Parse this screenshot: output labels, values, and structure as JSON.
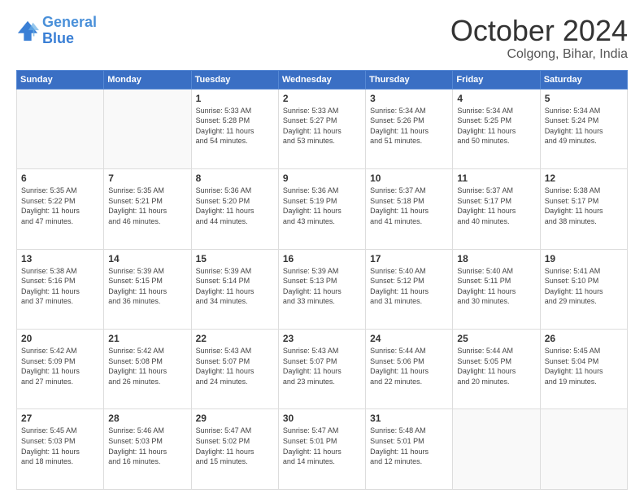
{
  "logo": {
    "line1": "General",
    "line2": "Blue"
  },
  "header": {
    "month": "October 2024",
    "location": "Colgong, Bihar, India"
  },
  "weekdays": [
    "Sunday",
    "Monday",
    "Tuesday",
    "Wednesday",
    "Thursday",
    "Friday",
    "Saturday"
  ],
  "weeks": [
    [
      {
        "day": "",
        "info": ""
      },
      {
        "day": "",
        "info": ""
      },
      {
        "day": "1",
        "info": "Sunrise: 5:33 AM\nSunset: 5:28 PM\nDaylight: 11 hours\nand 54 minutes."
      },
      {
        "day": "2",
        "info": "Sunrise: 5:33 AM\nSunset: 5:27 PM\nDaylight: 11 hours\nand 53 minutes."
      },
      {
        "day": "3",
        "info": "Sunrise: 5:34 AM\nSunset: 5:26 PM\nDaylight: 11 hours\nand 51 minutes."
      },
      {
        "day": "4",
        "info": "Sunrise: 5:34 AM\nSunset: 5:25 PM\nDaylight: 11 hours\nand 50 minutes."
      },
      {
        "day": "5",
        "info": "Sunrise: 5:34 AM\nSunset: 5:24 PM\nDaylight: 11 hours\nand 49 minutes."
      }
    ],
    [
      {
        "day": "6",
        "info": "Sunrise: 5:35 AM\nSunset: 5:22 PM\nDaylight: 11 hours\nand 47 minutes."
      },
      {
        "day": "7",
        "info": "Sunrise: 5:35 AM\nSunset: 5:21 PM\nDaylight: 11 hours\nand 46 minutes."
      },
      {
        "day": "8",
        "info": "Sunrise: 5:36 AM\nSunset: 5:20 PM\nDaylight: 11 hours\nand 44 minutes."
      },
      {
        "day": "9",
        "info": "Sunrise: 5:36 AM\nSunset: 5:19 PM\nDaylight: 11 hours\nand 43 minutes."
      },
      {
        "day": "10",
        "info": "Sunrise: 5:37 AM\nSunset: 5:18 PM\nDaylight: 11 hours\nand 41 minutes."
      },
      {
        "day": "11",
        "info": "Sunrise: 5:37 AM\nSunset: 5:17 PM\nDaylight: 11 hours\nand 40 minutes."
      },
      {
        "day": "12",
        "info": "Sunrise: 5:38 AM\nSunset: 5:17 PM\nDaylight: 11 hours\nand 38 minutes."
      }
    ],
    [
      {
        "day": "13",
        "info": "Sunrise: 5:38 AM\nSunset: 5:16 PM\nDaylight: 11 hours\nand 37 minutes."
      },
      {
        "day": "14",
        "info": "Sunrise: 5:39 AM\nSunset: 5:15 PM\nDaylight: 11 hours\nand 36 minutes."
      },
      {
        "day": "15",
        "info": "Sunrise: 5:39 AM\nSunset: 5:14 PM\nDaylight: 11 hours\nand 34 minutes."
      },
      {
        "day": "16",
        "info": "Sunrise: 5:39 AM\nSunset: 5:13 PM\nDaylight: 11 hours\nand 33 minutes."
      },
      {
        "day": "17",
        "info": "Sunrise: 5:40 AM\nSunset: 5:12 PM\nDaylight: 11 hours\nand 31 minutes."
      },
      {
        "day": "18",
        "info": "Sunrise: 5:40 AM\nSunset: 5:11 PM\nDaylight: 11 hours\nand 30 minutes."
      },
      {
        "day": "19",
        "info": "Sunrise: 5:41 AM\nSunset: 5:10 PM\nDaylight: 11 hours\nand 29 minutes."
      }
    ],
    [
      {
        "day": "20",
        "info": "Sunrise: 5:42 AM\nSunset: 5:09 PM\nDaylight: 11 hours\nand 27 minutes."
      },
      {
        "day": "21",
        "info": "Sunrise: 5:42 AM\nSunset: 5:08 PM\nDaylight: 11 hours\nand 26 minutes."
      },
      {
        "day": "22",
        "info": "Sunrise: 5:43 AM\nSunset: 5:07 PM\nDaylight: 11 hours\nand 24 minutes."
      },
      {
        "day": "23",
        "info": "Sunrise: 5:43 AM\nSunset: 5:07 PM\nDaylight: 11 hours\nand 23 minutes."
      },
      {
        "day": "24",
        "info": "Sunrise: 5:44 AM\nSunset: 5:06 PM\nDaylight: 11 hours\nand 22 minutes."
      },
      {
        "day": "25",
        "info": "Sunrise: 5:44 AM\nSunset: 5:05 PM\nDaylight: 11 hours\nand 20 minutes."
      },
      {
        "day": "26",
        "info": "Sunrise: 5:45 AM\nSunset: 5:04 PM\nDaylight: 11 hours\nand 19 minutes."
      }
    ],
    [
      {
        "day": "27",
        "info": "Sunrise: 5:45 AM\nSunset: 5:03 PM\nDaylight: 11 hours\nand 18 minutes."
      },
      {
        "day": "28",
        "info": "Sunrise: 5:46 AM\nSunset: 5:03 PM\nDaylight: 11 hours\nand 16 minutes."
      },
      {
        "day": "29",
        "info": "Sunrise: 5:47 AM\nSunset: 5:02 PM\nDaylight: 11 hours\nand 15 minutes."
      },
      {
        "day": "30",
        "info": "Sunrise: 5:47 AM\nSunset: 5:01 PM\nDaylight: 11 hours\nand 14 minutes."
      },
      {
        "day": "31",
        "info": "Sunrise: 5:48 AM\nSunset: 5:01 PM\nDaylight: 11 hours\nand 12 minutes."
      },
      {
        "day": "",
        "info": ""
      },
      {
        "day": "",
        "info": ""
      }
    ]
  ]
}
